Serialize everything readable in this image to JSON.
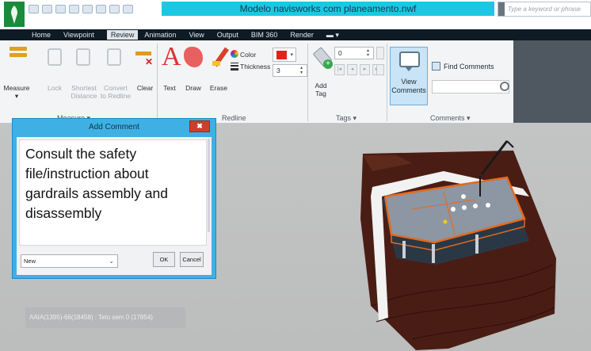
{
  "window": {
    "title": "Modelo navisworks com planeamento.nwf",
    "search_placeholder": "Type a keyword or phrase"
  },
  "tabs": [
    {
      "label": "Home"
    },
    {
      "label": "Viewpoint"
    },
    {
      "label": "Review",
      "active": true
    },
    {
      "label": "Animation"
    },
    {
      "label": "View"
    },
    {
      "label": "Output"
    },
    {
      "label": "BIM 360"
    },
    {
      "label": "Render"
    },
    {
      "label": "▬ ▾"
    }
  ],
  "ribbon": {
    "measure": {
      "measure": "Measure",
      "lock": "Lock",
      "shortest_distance": "Shortest\nDistance",
      "convert_to_redline": "Convert\nto Redline",
      "clear": "Clear",
      "panel_label": "Measure ▾"
    },
    "redline": {
      "text": "Text",
      "draw": "Draw",
      "erase": "Erase",
      "color_label": "Color",
      "thickness_label": "Thickness",
      "thickness_value": "3",
      "color_value": "#e2231a",
      "panel_label": "Redline"
    },
    "tags": {
      "add_tag": "Add\nTag",
      "tag_value": "0",
      "panel_label": "Tags ▾"
    },
    "comments": {
      "view_comments": "View\nComments",
      "find_comments": "Find Comments",
      "panel_label": "Comments ▾"
    }
  },
  "viewport": {
    "status_text": "AAIA(1395)-66(18458) : Teto sem 0 (17854)"
  },
  "dialog": {
    "title": "Add Comment",
    "close_label": "✖",
    "comment_text": "Consult the safety\nfile/instruction about\ngardrails assembly and\ndisassembly",
    "status_value": "New",
    "ok_label": "OK",
    "cancel_label": "Cancel"
  }
}
